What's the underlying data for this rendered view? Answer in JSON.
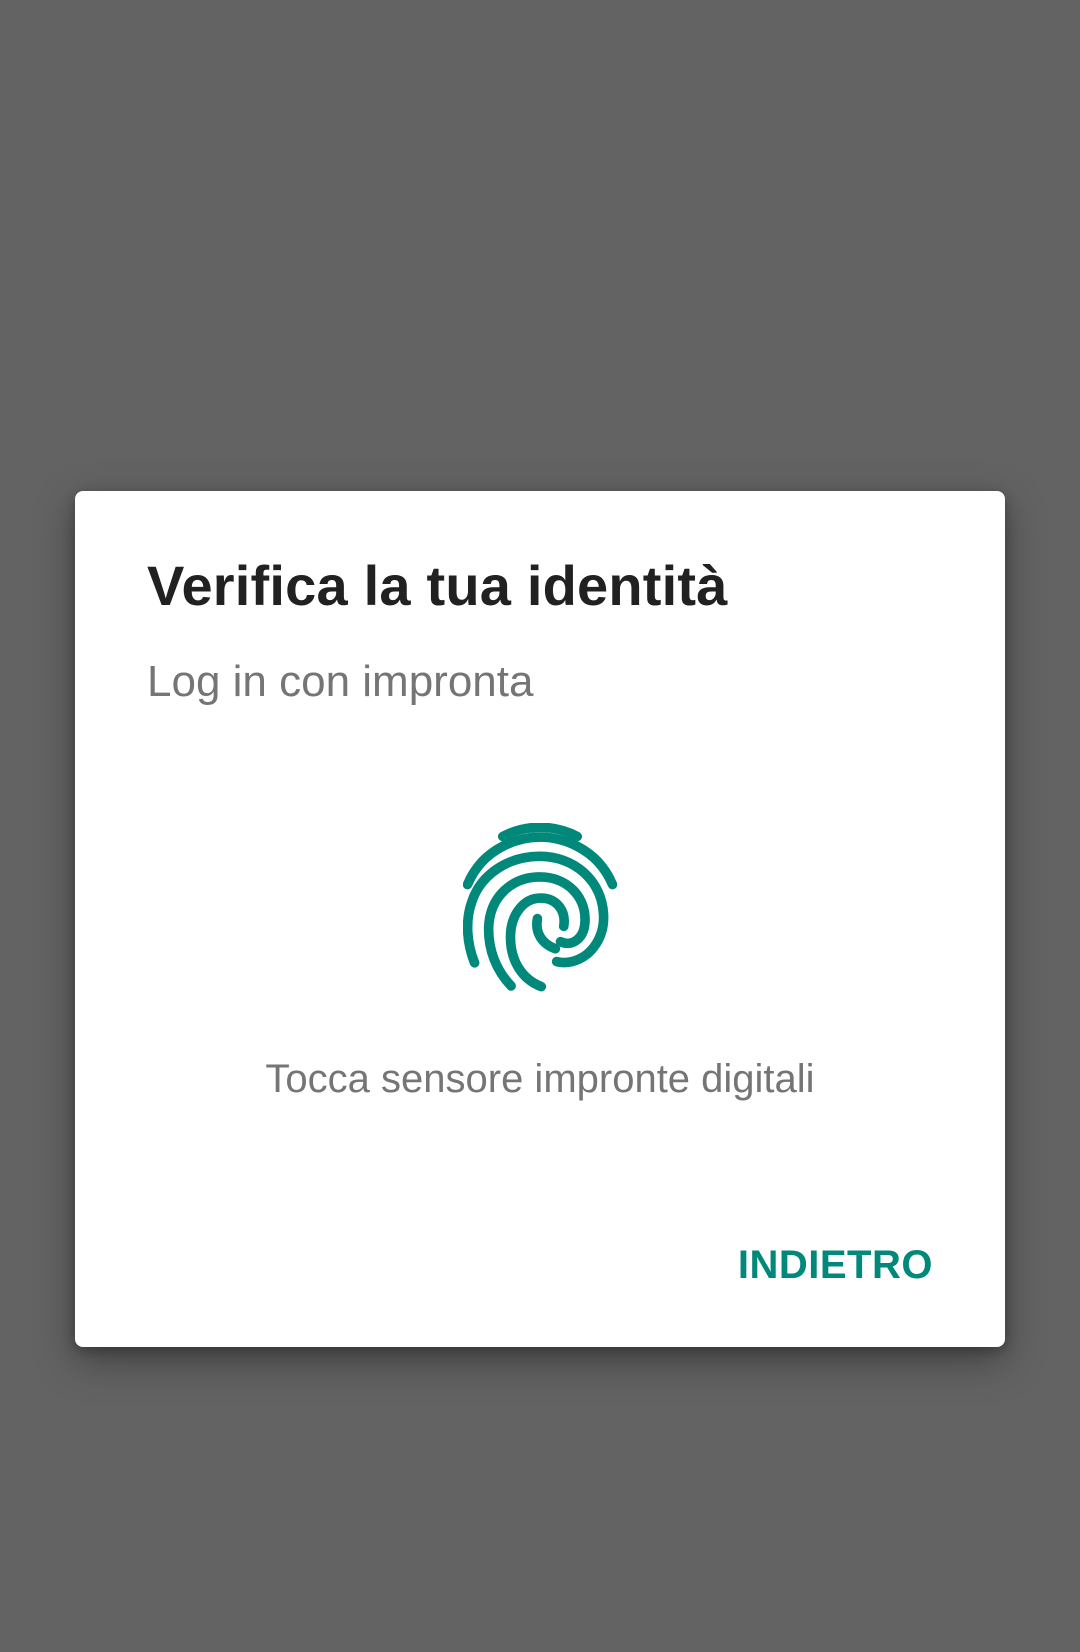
{
  "dialog": {
    "title": "Verifica la tua identità",
    "subtitle": "Log in con impronta",
    "icon": "fingerprint-icon",
    "hint": "Tocca sensore impronte digitali",
    "negative_button_label": "INDIETRO"
  },
  "colors": {
    "accent": "#00897b",
    "scrim": "#636363",
    "title_text": "#212121",
    "secondary_text": "#757575"
  }
}
